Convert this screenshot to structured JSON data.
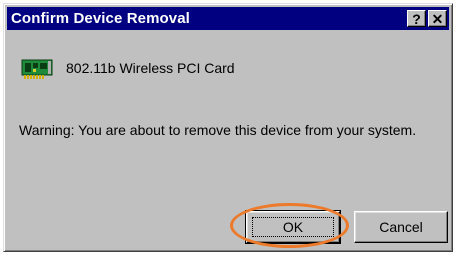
{
  "dialog": {
    "title": "Confirm Device Removal",
    "help_button": "?",
    "close_button": "✕",
    "device_name": "802.11b Wireless PCI Card",
    "warning": "Warning: You are about to remove this device from your system.",
    "ok_label": "OK",
    "cancel_label": "Cancel"
  },
  "icons": {
    "device": "network-card-icon",
    "help": "help-icon",
    "close": "close-icon"
  },
  "colors": {
    "titlebar": "#000080",
    "dialog_face": "#c0c0c0",
    "highlight": "#ec7a2a",
    "card_green": "#1f8a3a"
  }
}
